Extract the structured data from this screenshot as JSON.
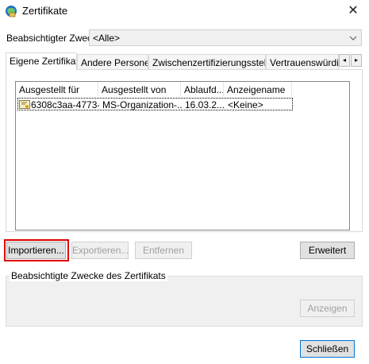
{
  "window": {
    "title": "Zertifikate",
    "close_glyph": "✕"
  },
  "purpose": {
    "label": "Beabsichtigter Zweck:",
    "value": "<Alle>"
  },
  "tabs": [
    {
      "label": "Eigene Zertifikate"
    },
    {
      "label": "Andere Personen"
    },
    {
      "label": "Zwischenzertifizierungsstellen"
    },
    {
      "label": "Vertrauenswürdige"
    }
  ],
  "tab_scroll": {
    "left": "◂",
    "right": "▸"
  },
  "list": {
    "columns": [
      "Ausgestellt für",
      "Ausgestellt von",
      "Ablaufd...",
      "Anzeigename"
    ],
    "rows": [
      {
        "issued_to": "6308c3aa-4773-...",
        "issued_by": "MS-Organization-...",
        "expires": "16.03.2...",
        "display_name": "<Keine>"
      }
    ]
  },
  "buttons": {
    "import": "Importieren...",
    "export": "Exportieren...",
    "remove": "Entfernen",
    "advanced": "Erweitert",
    "view": "Anzeigen",
    "close": "Schließen"
  },
  "group": {
    "label": "Beabsichtigte Zwecke des Zertifikats"
  },
  "colors": {
    "highlight": "#e00000",
    "window_bg": "#ffffff",
    "disabled_text": "#a0a0a0"
  }
}
